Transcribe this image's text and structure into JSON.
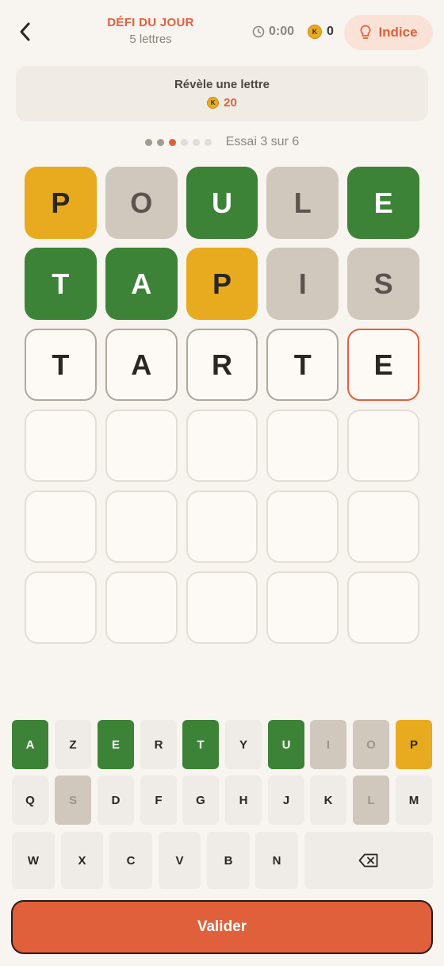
{
  "header": {
    "title": "DÉFI DU JOUR",
    "subtitle": "5 lettres",
    "timer": "0:00",
    "coin_symbol": "K",
    "coins": "0",
    "hint_label": "Indice"
  },
  "reveal": {
    "label": "Révèle une lettre",
    "cost": "20"
  },
  "progress": {
    "text": "Essai 3 sur 6",
    "current": 3,
    "total": 6
  },
  "board": {
    "rows": [
      [
        {
          "l": "P",
          "s": "present"
        },
        {
          "l": "O",
          "s": "absent"
        },
        {
          "l": "U",
          "s": "correct"
        },
        {
          "l": "L",
          "s": "absent"
        },
        {
          "l": "E",
          "s": "correct"
        }
      ],
      [
        {
          "l": "T",
          "s": "correct"
        },
        {
          "l": "A",
          "s": "correct"
        },
        {
          "l": "P",
          "s": "present"
        },
        {
          "l": "I",
          "s": "absent"
        },
        {
          "l": "S",
          "s": "absent"
        }
      ],
      [
        {
          "l": "T",
          "s": "typed"
        },
        {
          "l": "A",
          "s": "typed"
        },
        {
          "l": "R",
          "s": "typed"
        },
        {
          "l": "T",
          "s": "typed"
        },
        {
          "l": "E",
          "s": "cursor"
        }
      ],
      [
        {
          "l": "",
          "s": "empty"
        },
        {
          "l": "",
          "s": "empty"
        },
        {
          "l": "",
          "s": "empty"
        },
        {
          "l": "",
          "s": "empty"
        },
        {
          "l": "",
          "s": "empty"
        }
      ],
      [
        {
          "l": "",
          "s": "empty"
        },
        {
          "l": "",
          "s": "empty"
        },
        {
          "l": "",
          "s": "empty"
        },
        {
          "l": "",
          "s": "empty"
        },
        {
          "l": "",
          "s": "empty"
        }
      ],
      [
        {
          "l": "",
          "s": "empty"
        },
        {
          "l": "",
          "s": "empty"
        },
        {
          "l": "",
          "s": "empty"
        },
        {
          "l": "",
          "s": "empty"
        },
        {
          "l": "",
          "s": "empty"
        }
      ]
    ]
  },
  "keyboard": {
    "rows": [
      [
        {
          "k": "A",
          "s": "correct"
        },
        {
          "k": "Z",
          "s": "default"
        },
        {
          "k": "E",
          "s": "correct"
        },
        {
          "k": "R",
          "s": "default"
        },
        {
          "k": "T",
          "s": "correct"
        },
        {
          "k": "Y",
          "s": "default"
        },
        {
          "k": "U",
          "s": "correct"
        },
        {
          "k": "I",
          "s": "absent"
        },
        {
          "k": "O",
          "s": "absent"
        },
        {
          "k": "P",
          "s": "present"
        }
      ],
      [
        {
          "k": "Q",
          "s": "default"
        },
        {
          "k": "S",
          "s": "absent"
        },
        {
          "k": "D",
          "s": "default"
        },
        {
          "k": "F",
          "s": "default"
        },
        {
          "k": "G",
          "s": "default"
        },
        {
          "k": "H",
          "s": "default"
        },
        {
          "k": "J",
          "s": "default"
        },
        {
          "k": "K",
          "s": "default"
        },
        {
          "k": "L",
          "s": "absent"
        },
        {
          "k": "M",
          "s": "default"
        }
      ],
      [
        {
          "k": "W",
          "s": "default"
        },
        {
          "k": "X",
          "s": "default"
        },
        {
          "k": "C",
          "s": "default"
        },
        {
          "k": "V",
          "s": "default"
        },
        {
          "k": "B",
          "s": "default"
        },
        {
          "k": "N",
          "s": "default"
        },
        {
          "k": "backspace-icon",
          "s": "default"
        }
      ]
    ]
  },
  "submit_label": "Valider",
  "colors": {
    "accent": "#e0603b",
    "correct": "#3c8338",
    "present": "#e8ab1f",
    "absent": "#d0c8bd"
  }
}
